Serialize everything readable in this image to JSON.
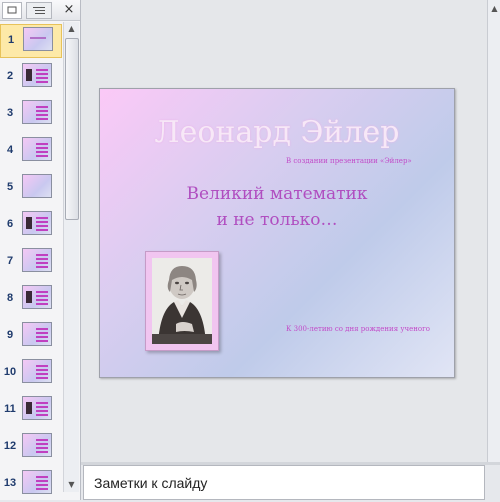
{
  "thumbnails": {
    "numbers": [
      "1",
      "2",
      "3",
      "4",
      "5",
      "6",
      "7",
      "8",
      "9",
      "10",
      "11",
      "12",
      "13"
    ],
    "selected": "1"
  },
  "pane": {
    "close_glyph": "×"
  },
  "slide": {
    "title": "Леонард Эйлер",
    "subtitle": "В создании презентации «Эйлер»",
    "heading_line1": "Великий математик",
    "heading_line2": "и не только…",
    "note": "К 300-летию со дня рождения ученого"
  },
  "notes": {
    "placeholder": "Заметки к слайду"
  }
}
